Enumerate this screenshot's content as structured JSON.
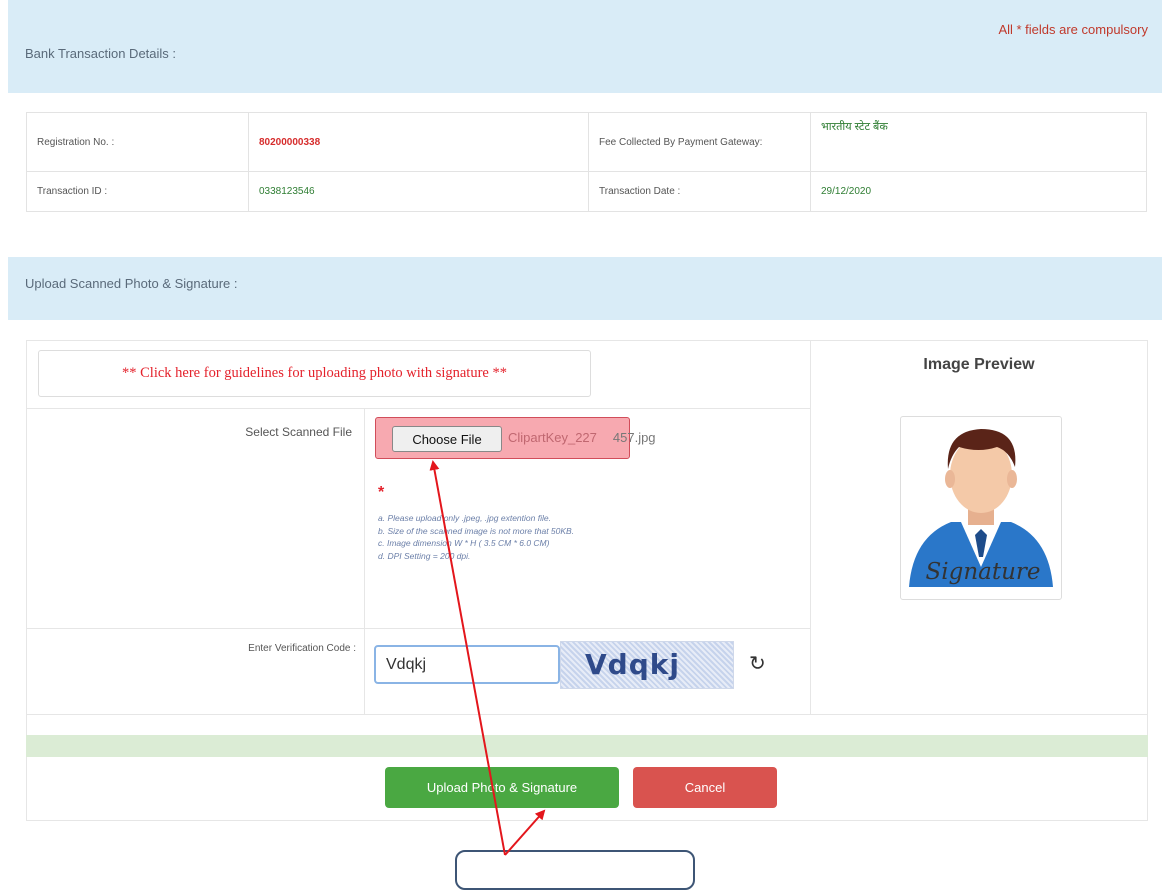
{
  "header": {
    "bank_section_title": "Bank Transaction Details :",
    "compulsory_note": "All * fields are compulsory"
  },
  "transaction": {
    "registration_label": "Registration No. :",
    "registration_value": "80200000338",
    "fee_label": "Fee Collected By Payment Gateway:",
    "fee_value": "भारतीय स्टेट बैंक",
    "transaction_id_label": "Transaction ID :",
    "transaction_id_value": "0338123546",
    "transaction_date_label": "Transaction Date :",
    "transaction_date_value": "29/12/2020"
  },
  "upload": {
    "section_title": "Upload Scanned Photo & Signature :",
    "guidelines_link": "** Click here for guidelines for uploading photo with signature **",
    "preview_title": "Image Preview",
    "select_file_label": "Select Scanned File",
    "choose_file_button": "Choose File",
    "file_name_covered": "ClipartKey_227",
    "file_name_visible": "457.jpg",
    "required_marker": "*",
    "notes": [
      "a. Please upload only .jpeg, .jpg extention file.",
      "b. Size of the scanned image is not more that 50KB.",
      "c. Image dimension W * H ( 3.5 CM * 6.0 CM)",
      "d. DPI Setting = 200 dpi."
    ],
    "verification_label": "Enter Verification Code :",
    "verification_value": "Vdqkj",
    "captcha_text": "Vdqkj",
    "refresh_icon": "refresh-icon",
    "preview_signature_text": "Signature"
  },
  "actions": {
    "upload_button": "Upload Photo & Signature",
    "cancel_button": "Cancel"
  },
  "colors": {
    "section_header_bg": "#d9ecf7",
    "upload_button": "#4aa842",
    "cancel_button": "#d9534f",
    "annotation_arrow": "#e3161c",
    "link_red": "#e4222c"
  }
}
